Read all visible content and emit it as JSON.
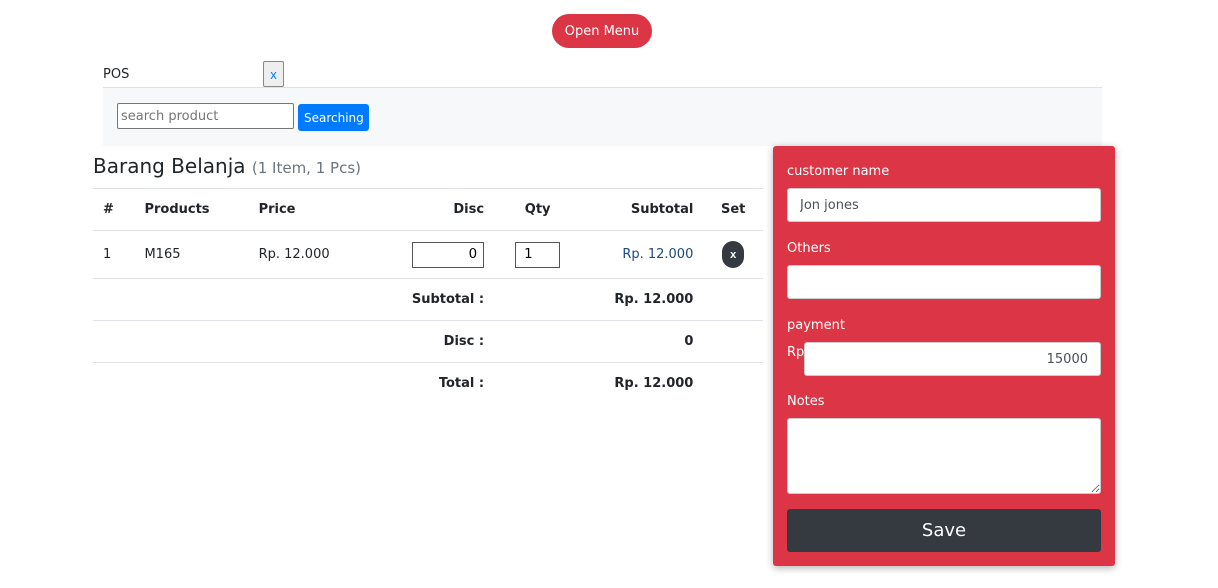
{
  "header": {
    "open_menu": "Open Menu"
  },
  "tab": {
    "label": "POS",
    "close": "x"
  },
  "search": {
    "placeholder": "search product",
    "button": "Searching"
  },
  "cart": {
    "title": "Barang Belanja",
    "summary": "(1 Item, 1 Pcs)",
    "columns": [
      "#",
      "Products",
      "Price",
      "Disc",
      "Qty",
      "Subtotal",
      "Set"
    ],
    "rows": [
      {
        "no": "1",
        "product": "M165",
        "price": "Rp. 12.000",
        "disc": "0",
        "qty": "1",
        "subtotal": "Rp. 12.000",
        "remove": "x"
      }
    ],
    "totals": [
      {
        "label": "Subtotal :",
        "value": "Rp. 12.000"
      },
      {
        "label": "Disc :",
        "value": "0"
      },
      {
        "label": "Total :",
        "value": "Rp. 12.000"
      }
    ]
  },
  "form": {
    "customer_label": "customer name",
    "customer_value": "Jon jones",
    "others_label": "Others",
    "others_value": "",
    "payment_label": "payment",
    "payment_prefix": "Rp",
    "payment_value": "15000",
    "notes_label": "Notes",
    "notes_value": "",
    "save": "Save"
  },
  "colors": {
    "accent": "#dc3545",
    "primary": "#007bff",
    "dark": "#343a40"
  }
}
